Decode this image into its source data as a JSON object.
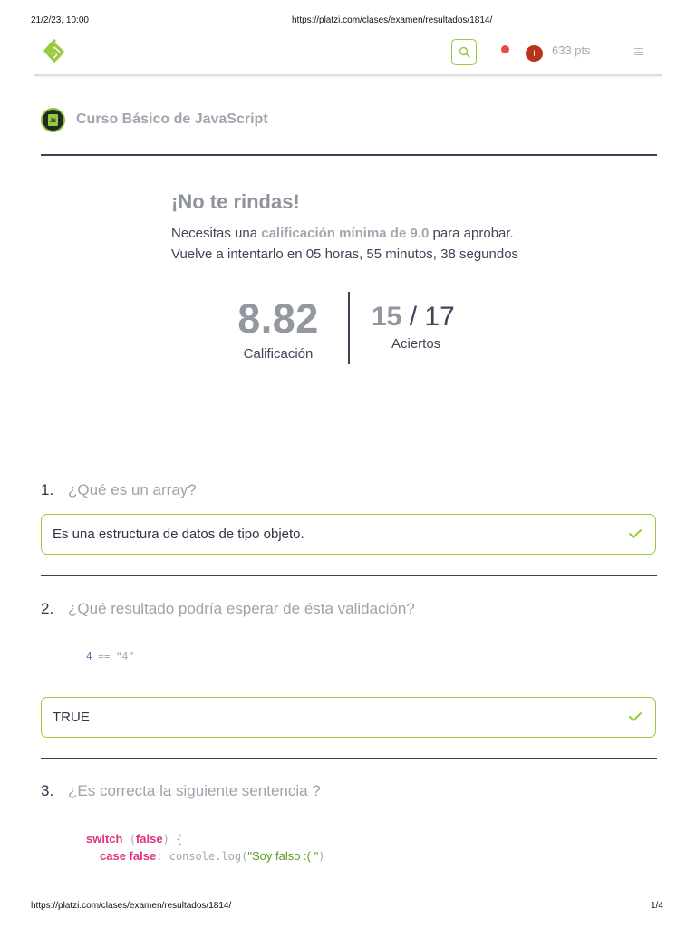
{
  "print_header": {
    "datetime": "21/2/23, 10:00",
    "url": "https://platzi.com/clases/examen/resultados/1814/"
  },
  "print_footer": {
    "url": "https://platzi.com/clases/examen/resultados/1814/",
    "page": "1/4"
  },
  "nav": {
    "avatar_initial": "I",
    "points": "633 pts",
    "accent_color": "#98ca3f",
    "notification_color": "#e84a4a"
  },
  "course": {
    "badge_text": "JS",
    "title": "Curso Básico de JavaScript"
  },
  "result": {
    "title": "¡No te rindas!",
    "line1_prefix": "Necesitas una ",
    "line1_highlight": "calificación mínima de 9.0",
    "line1_suffix": " para aprobar.",
    "line2": "Vuelve a intentarlo en 05 horas, 55 minutos, 38 segundos",
    "score": "8.82",
    "score_label": "Calificación",
    "correct": "15",
    "separator": " / ",
    "total": "17",
    "hits_label": "Aciertos"
  },
  "questions": [
    {
      "number": "1.",
      "text": "¿Qué es un array?",
      "answer": "Es una estructura de datos de tipo objeto."
    },
    {
      "number": "2.",
      "text": "¿Qué resultado podría esperar de ésta validación?",
      "code": {
        "left": "4",
        "op": " == ",
        "right": "“4”"
      },
      "answer": "TRUE"
    },
    {
      "number": "3.",
      "text": "¿Es correcta la siguiente sentencia ?",
      "code": {
        "l1_kw": "switch",
        "l1_open": " (",
        "l1_arg": "false",
        "l1_close": ") {",
        "l2_kw1": "case",
        "l2_kw2": "false",
        "l2_colon": ":",
        "l2_call": " console.log(",
        "l2_str": "\"Soy falso :( \"",
        "l2_end": ")"
      }
    }
  ]
}
